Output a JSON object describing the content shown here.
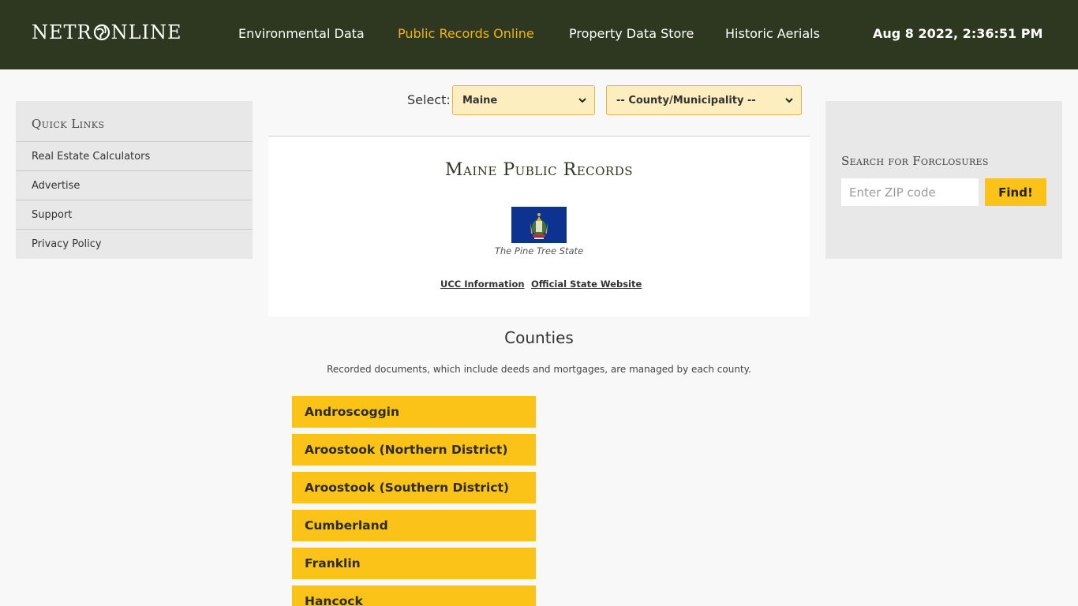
{
  "header": {
    "logo_left": "NETR",
    "logo_right": "NLINE",
    "nav": [
      {
        "label": "Environmental Data",
        "active": false
      },
      {
        "label": "Public Records Online",
        "active": true
      },
      {
        "label": "Property Data Store",
        "active": false
      },
      {
        "label": "Historic Aerials",
        "active": false
      }
    ],
    "datetime": "Aug 8 2022, 2:36:51 PM"
  },
  "quick_links": {
    "title": "Quick Links",
    "items": [
      "Real Estate Calculators",
      "Advertise",
      "Support",
      "Privacy Policy"
    ]
  },
  "selector": {
    "label": "Select:",
    "state_value": "Maine",
    "county_value": "-- County/Municipality --"
  },
  "state_card": {
    "title": "Maine Public Records",
    "nickname": "The Pine Tree State",
    "links": [
      "UCC Information",
      "Official State Website"
    ]
  },
  "counties": {
    "heading": "Counties",
    "description": "Recorded documents, which include deeds and mortgages, are managed by each county.",
    "items": [
      "Androscoggin",
      "Aroostook (Northern District)",
      "Aroostook (Southern District)",
      "Cumberland",
      "Franklin",
      "Hancock"
    ]
  },
  "foreclosures": {
    "title": "Search for Forclosures",
    "placeholder": "Enter ZIP code",
    "button": "Find!"
  },
  "colors": {
    "header_bg": "#2e3820",
    "accent": "#fbc217",
    "active_nav": "#f4b400"
  }
}
